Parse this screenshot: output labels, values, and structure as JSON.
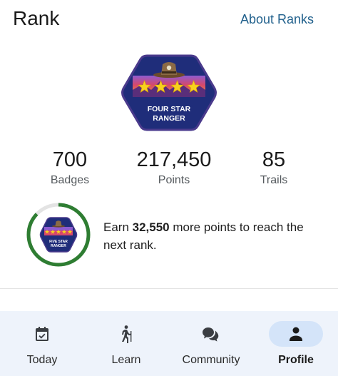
{
  "header": {
    "title": "Rank",
    "about_link": "About Ranks"
  },
  "current_rank": {
    "badge_line1": "FOUR STAR",
    "badge_line2": "RANGER",
    "stars": 4
  },
  "stats": [
    {
      "value": "700",
      "label": "Badges"
    },
    {
      "value": "217,450",
      "label": "Points"
    },
    {
      "value": "85",
      "label": "Trails"
    }
  ],
  "next_rank": {
    "badge_line1": "FIVE STAR",
    "badge_line2": "RANGER",
    "progress_fraction": 0.87,
    "text_before": "Earn ",
    "points": "32,550",
    "text_after": " more points to reach the next rank."
  },
  "colors": {
    "accent_link": "#1f5f8b",
    "progress_ring": "#2e7d32",
    "ring_track": "#e3e3e3",
    "badge_navy": "#1f2d7a",
    "nav_background": "#eef3fb",
    "nav_active_pill": "#d4e4f9"
  },
  "nav": [
    {
      "label": "Today",
      "icon": "calendar-check-icon",
      "active": false
    },
    {
      "label": "Learn",
      "icon": "hiker-icon",
      "active": false
    },
    {
      "label": "Community",
      "icon": "chat-bubbles-icon",
      "active": false
    },
    {
      "label": "Profile",
      "icon": "person-icon",
      "active": true
    }
  ]
}
